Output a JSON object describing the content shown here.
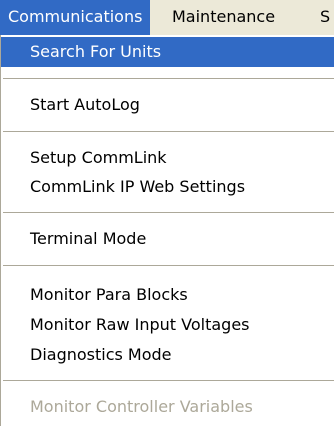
{
  "menubar": {
    "items": [
      {
        "label": "Communications"
      },
      {
        "label": "Maintenance"
      },
      {
        "label": "S"
      }
    ]
  },
  "menu": {
    "items": [
      {
        "label": "Search For Units"
      },
      {
        "label": "Start AutoLog"
      },
      {
        "label": "Setup CommLink"
      },
      {
        "label": "CommLink IP Web Settings"
      },
      {
        "label": "Terminal Mode"
      },
      {
        "label": "Monitor Para Blocks"
      },
      {
        "label": "Monitor Raw Input Voltages"
      },
      {
        "label": "Diagnostics Mode"
      },
      {
        "label": "Monitor Controller Variables"
      }
    ]
  }
}
